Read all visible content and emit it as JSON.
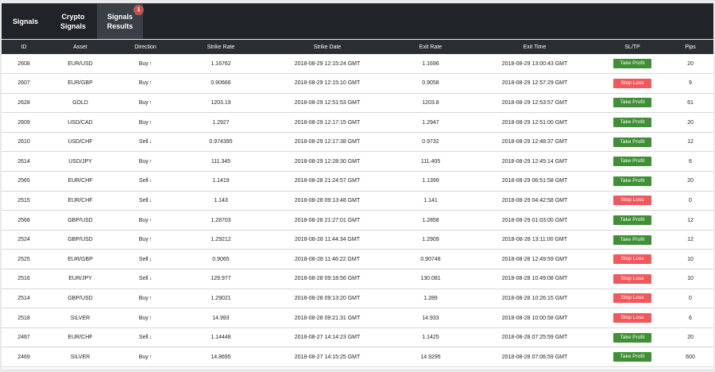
{
  "tabs": [
    {
      "label_line1": "Signals",
      "label_line2": ""
    },
    {
      "label_line1": "Crypto",
      "label_line2": "Signals"
    },
    {
      "label_line1": "Signals",
      "label_line2": "Results",
      "badge": "1"
    }
  ],
  "colors": {
    "take_profit": "#3f8f35",
    "stop_loss": "#f2575c",
    "header": "#2a2d31",
    "topbar": "#202327"
  },
  "table": {
    "columns": [
      "ID",
      "Asset",
      "Direction",
      "Strike Rate",
      "Strike Date",
      "Exit Rate",
      "Exit Time",
      "SL/TP",
      "Pips"
    ],
    "rows": [
      {
        "id": "2608",
        "asset": "EUR/USD",
        "direction": "Buy",
        "arrow": "up",
        "strike_rate": "1.16762",
        "strike_date": "2018-08-29 12:15:24 GMT",
        "exit_rate": "1.1696",
        "exit_time": "2018-08-29 13:00:43 GMT",
        "sltp": "Take Profit",
        "pips": "20"
      },
      {
        "id": "2607",
        "asset": "EUR/GBP",
        "direction": "Buy",
        "arrow": "up",
        "strike_rate": "0.90666",
        "strike_date": "2018-08-29 12:15:10 GMT",
        "exit_rate": "0.9058",
        "exit_time": "2018-08-29 12:57:29 GMT",
        "sltp": "Stop Loss",
        "pips": "9"
      },
      {
        "id": "2628",
        "asset": "GOLD",
        "direction": "Buy",
        "arrow": "up",
        "strike_rate": "1203.19",
        "strike_date": "2018-08-29 12:51:53 GMT",
        "exit_rate": "1203.8",
        "exit_time": "2018-08-29 12:53:57 GMT",
        "sltp": "Take Profit",
        "pips": "61"
      },
      {
        "id": "2609",
        "asset": "USD/CAD",
        "direction": "Buy",
        "arrow": "up",
        "strike_rate": "1.2927",
        "strike_date": "2018-08-29 12:17:15 GMT",
        "exit_rate": "1.2947",
        "exit_time": "2018-08-29 12:51:00 GMT",
        "sltp": "Take Profit",
        "pips": "20"
      },
      {
        "id": "2610",
        "asset": "USD/CHF",
        "direction": "Sell",
        "arrow": "down",
        "strike_rate": "0.974395",
        "strike_date": "2018-08-29 12:17:38 GMT",
        "exit_rate": "0.9732",
        "exit_time": "2018-08-29 12:48:37 GMT",
        "sltp": "Take Profit",
        "pips": "12"
      },
      {
        "id": "2614",
        "asset": "USD/JPY",
        "direction": "Buy",
        "arrow": "up",
        "strike_rate": "111.345",
        "strike_date": "2018-08-29 12:28:30 GMT",
        "exit_rate": "111.405",
        "exit_time": "2018-08-29 12:45:14 GMT",
        "sltp": "Take Profit",
        "pips": "6"
      },
      {
        "id": "2565",
        "asset": "EUR/CHF",
        "direction": "Sell",
        "arrow": "down",
        "strike_rate": "1.1419",
        "strike_date": "2018-08-28 21:24:57 GMT",
        "exit_rate": "1.1399",
        "exit_time": "2018-08-29 06:51:58 GMT",
        "sltp": "Take Profit",
        "pips": "20"
      },
      {
        "id": "2515",
        "asset": "EUR/CHF",
        "direction": "Sell",
        "arrow": "down",
        "strike_rate": "1.143",
        "strike_date": "2018-08-28 09:13:48 GMT",
        "exit_rate": "1.141",
        "exit_time": "2018-08-29 04:42:58 GMT",
        "sltp": "Stop Loss",
        "pips": "0"
      },
      {
        "id": "2568",
        "asset": "GBP/USD",
        "direction": "Buy",
        "arrow": "up",
        "strike_rate": "1.28703",
        "strike_date": "2018-08-28 21:27:01 GMT",
        "exit_rate": "1.2858",
        "exit_time": "2018-08-29 01:03:00 GMT",
        "sltp": "Take Profit",
        "pips": "12"
      },
      {
        "id": "2524",
        "asset": "GBP/USD",
        "direction": "Buy",
        "arrow": "up",
        "strike_rate": "1.29212",
        "strike_date": "2018-08-28 11:44:34 GMT",
        "exit_rate": "1.2909",
        "exit_time": "2018-08-28 13:11:00 GMT",
        "sltp": "Take Profit",
        "pips": "12"
      },
      {
        "id": "2525",
        "asset": "EUR/GBP",
        "direction": "Sell",
        "arrow": "down",
        "strike_rate": "0.9065",
        "strike_date": "2018-08-28 11:46:22 GMT",
        "exit_rate": "0.90748",
        "exit_time": "2018-08-28 12:49:59 GMT",
        "sltp": "Stop Loss",
        "pips": "10"
      },
      {
        "id": "2516",
        "asset": "EUR/JPY",
        "direction": "Sell",
        "arrow": "down",
        "strike_rate": "129.977",
        "strike_date": "2018-08-28 09:18:56 GMT",
        "exit_rate": "130.081",
        "exit_time": "2018-08-28 10:49:08 GMT",
        "sltp": "Stop Loss",
        "pips": "10"
      },
      {
        "id": "2514",
        "asset": "GBP/USD",
        "direction": "Buy",
        "arrow": "up",
        "strike_rate": "1.29021",
        "strike_date": "2018-08-28 09:13:20 GMT",
        "exit_rate": "1.289",
        "exit_time": "2018-08-28 10:26:15 GMT",
        "sltp": "Stop Loss",
        "pips": "0"
      },
      {
        "id": "2518",
        "asset": "SILVER",
        "direction": "Buy",
        "arrow": "up",
        "strike_rate": "14.993",
        "strike_date": "2018-08-28 09:21:31 GMT",
        "exit_rate": "14.933",
        "exit_time": "2018-08-28 10:00:58 GMT",
        "sltp": "Stop Loss",
        "pips": "6"
      },
      {
        "id": "2467",
        "asset": "EUR/CHF",
        "direction": "Sell",
        "arrow": "down",
        "strike_rate": "1.14448",
        "strike_date": "2018-08-27 14:14:23 GMT",
        "exit_rate": "1.1425",
        "exit_time": "2018-08-28 07:25:59 GMT",
        "sltp": "Take Profit",
        "pips": "20"
      },
      {
        "id": "2469",
        "asset": "SILVER",
        "direction": "Buy",
        "arrow": "up",
        "strike_rate": "14.8695",
        "strike_date": "2018-08-27 14:15:25 GMT",
        "exit_rate": "14.9295",
        "exit_time": "2018-08-28 07:06:59 GMT",
        "sltp": "Take Profit",
        "pips": "600"
      }
    ]
  }
}
